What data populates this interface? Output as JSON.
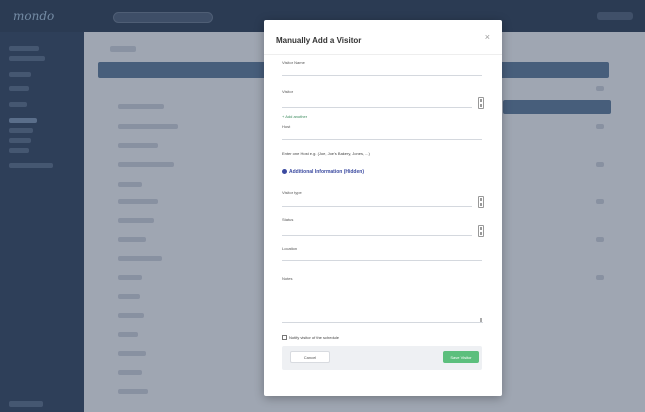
{
  "app": {
    "logo": "mondo"
  },
  "modal": {
    "title": "Manually Add a Visitor",
    "fields": {
      "visitor_name": {
        "label": "Visitor Name",
        "value": ""
      },
      "visitor_id": {
        "label": "Visitor",
        "value": ""
      },
      "add_link": "+ Add another",
      "host": {
        "label": "Host",
        "value": ""
      }
    },
    "hint": "Enter one Host e.g. (Joe, Joe's Bakery, Jones, ...)",
    "additional_section": "Additional Information (Hidden)",
    "extra_fields": {
      "visitor_type": {
        "label": "Visitor type",
        "value": ""
      },
      "status": {
        "label": "Status",
        "value": ""
      },
      "location": {
        "label": "Location",
        "value": ""
      },
      "notes": {
        "label": "Notes",
        "value": ""
      }
    },
    "checkbox_label": "Notify visitor of the schedule",
    "cancel_label": "Cancel",
    "save_label": "Save Visitor"
  },
  "colors": {
    "topbar": "#2e3f55",
    "sidebar": "#334660",
    "accent_blue": "#3b4aa0",
    "success_green": "#5cbf7d",
    "link_green": "#3a8a5c"
  }
}
